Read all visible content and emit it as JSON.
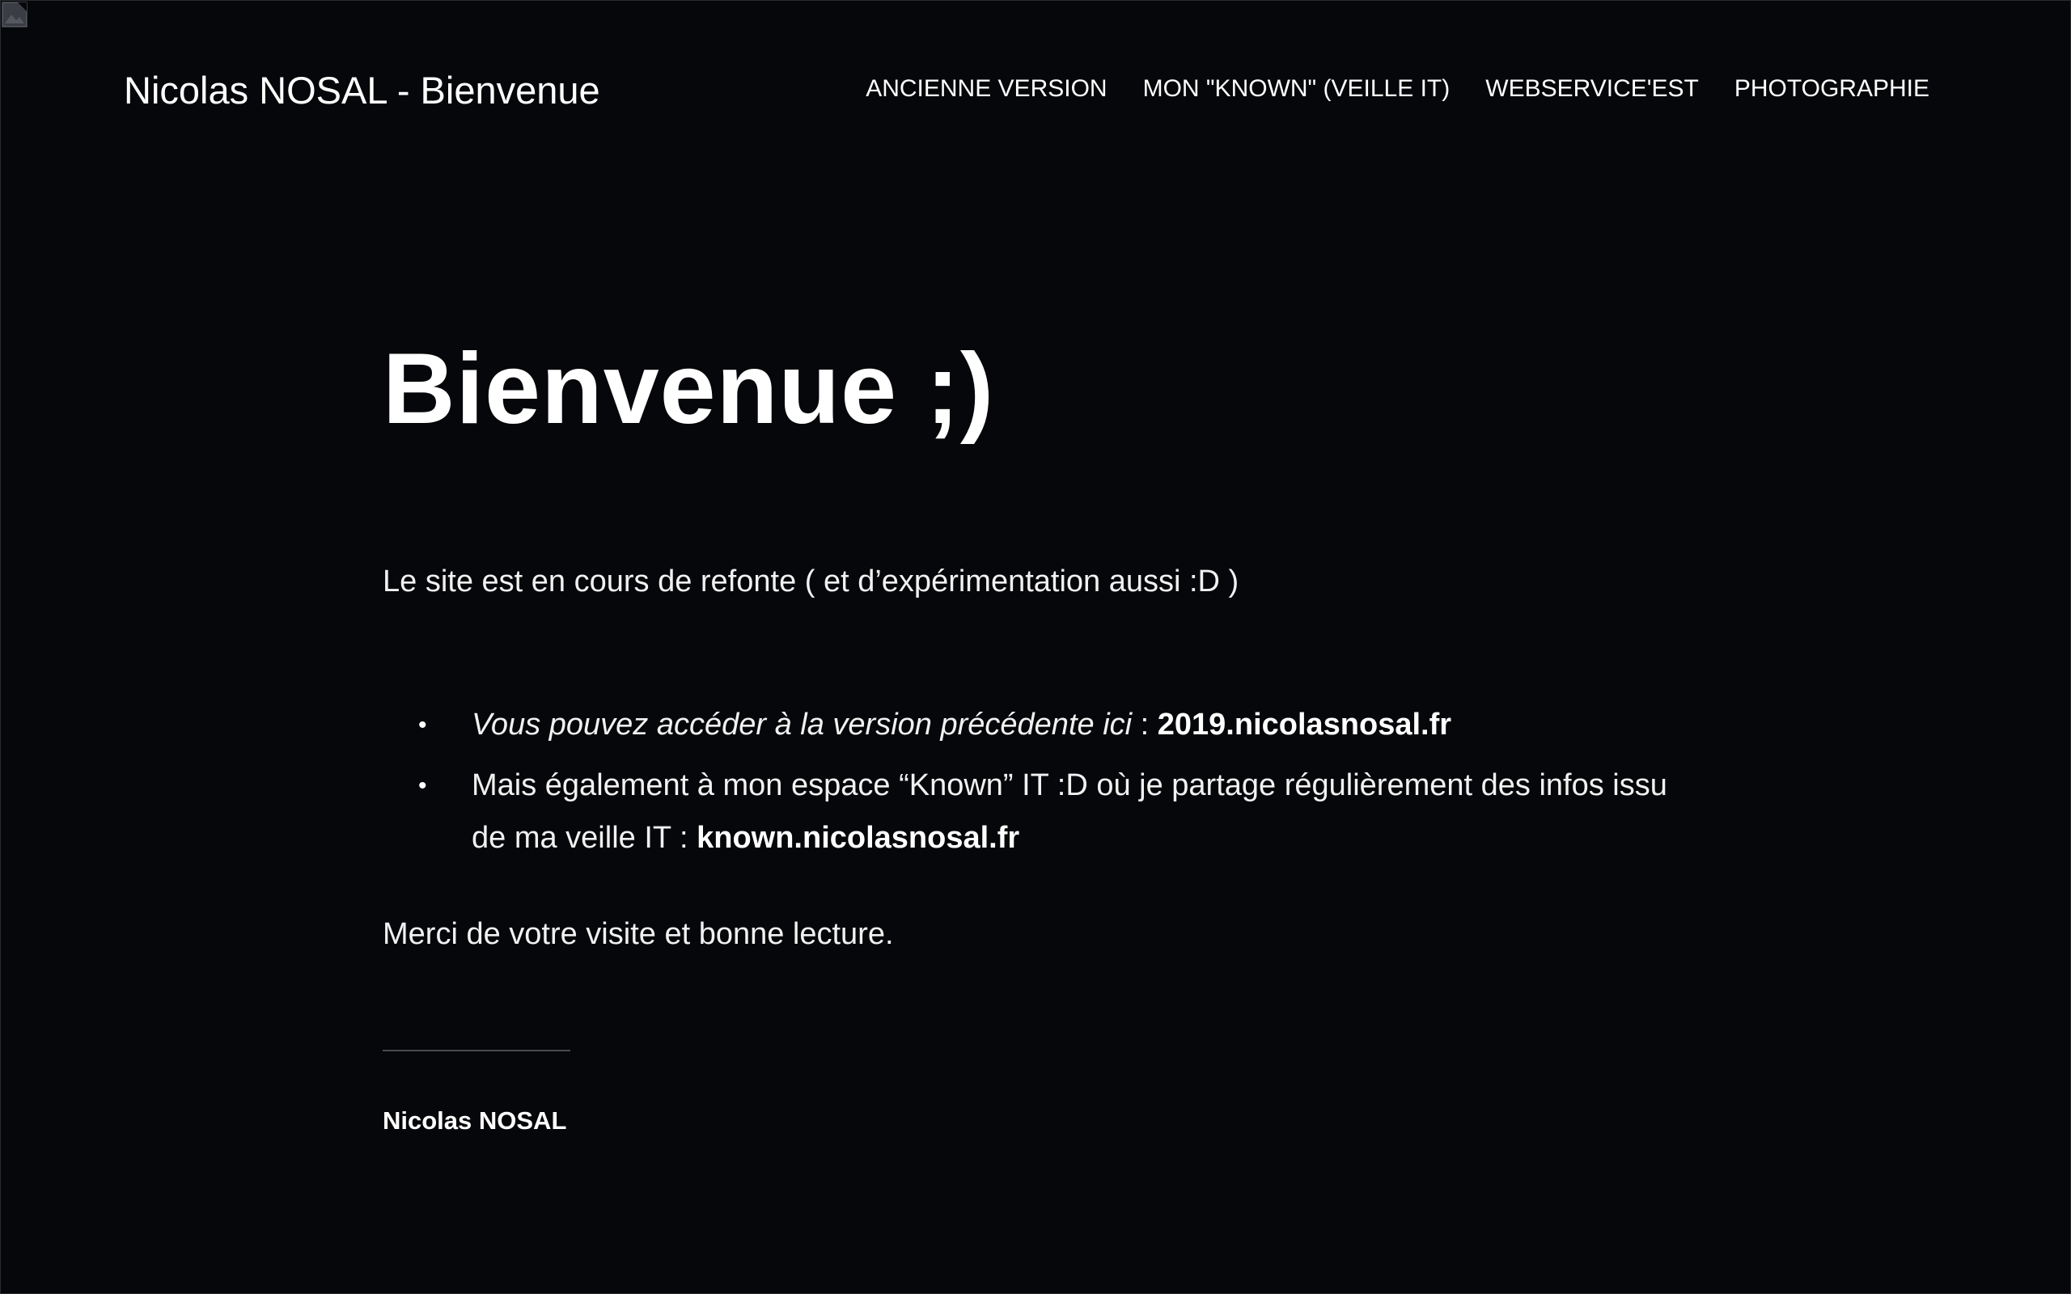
{
  "header": {
    "site_title": "Nicolas NOSAL - Bienvenue",
    "nav": [
      {
        "label": "ANCIENNE VERSION"
      },
      {
        "label": "MON \"KNOWN\" (VEILLE IT)"
      },
      {
        "label": "WEBSERVICE'EST"
      },
      {
        "label": "PHOTOGRAPHIE"
      }
    ]
  },
  "main": {
    "heading": "Bienvenue ;)",
    "intro": "Le site est en cours de refonte ( et d’expérimentation aussi :D )",
    "list": [
      {
        "text_italic": "Vous pouvez accéder à la version précédente ici",
        "separator": " : ",
        "link": "2019.nicolasnosal.fr"
      },
      {
        "text": "Mais également à mon espace “Known” IT :D où je partage régulièrement des infos issu de ma veille IT : ",
        "link": "known.nicolasnosal.fr"
      }
    ],
    "outro": "Merci de votre visite et bonne lecture.",
    "author": "Nicolas NOSAL"
  },
  "colors": {
    "background": "#06070a",
    "text": "#ffffff",
    "divider": "#4a4b4f"
  },
  "icons": {
    "broken_image": "broken-image-icon",
    "bullet": "bullet-icon"
  }
}
